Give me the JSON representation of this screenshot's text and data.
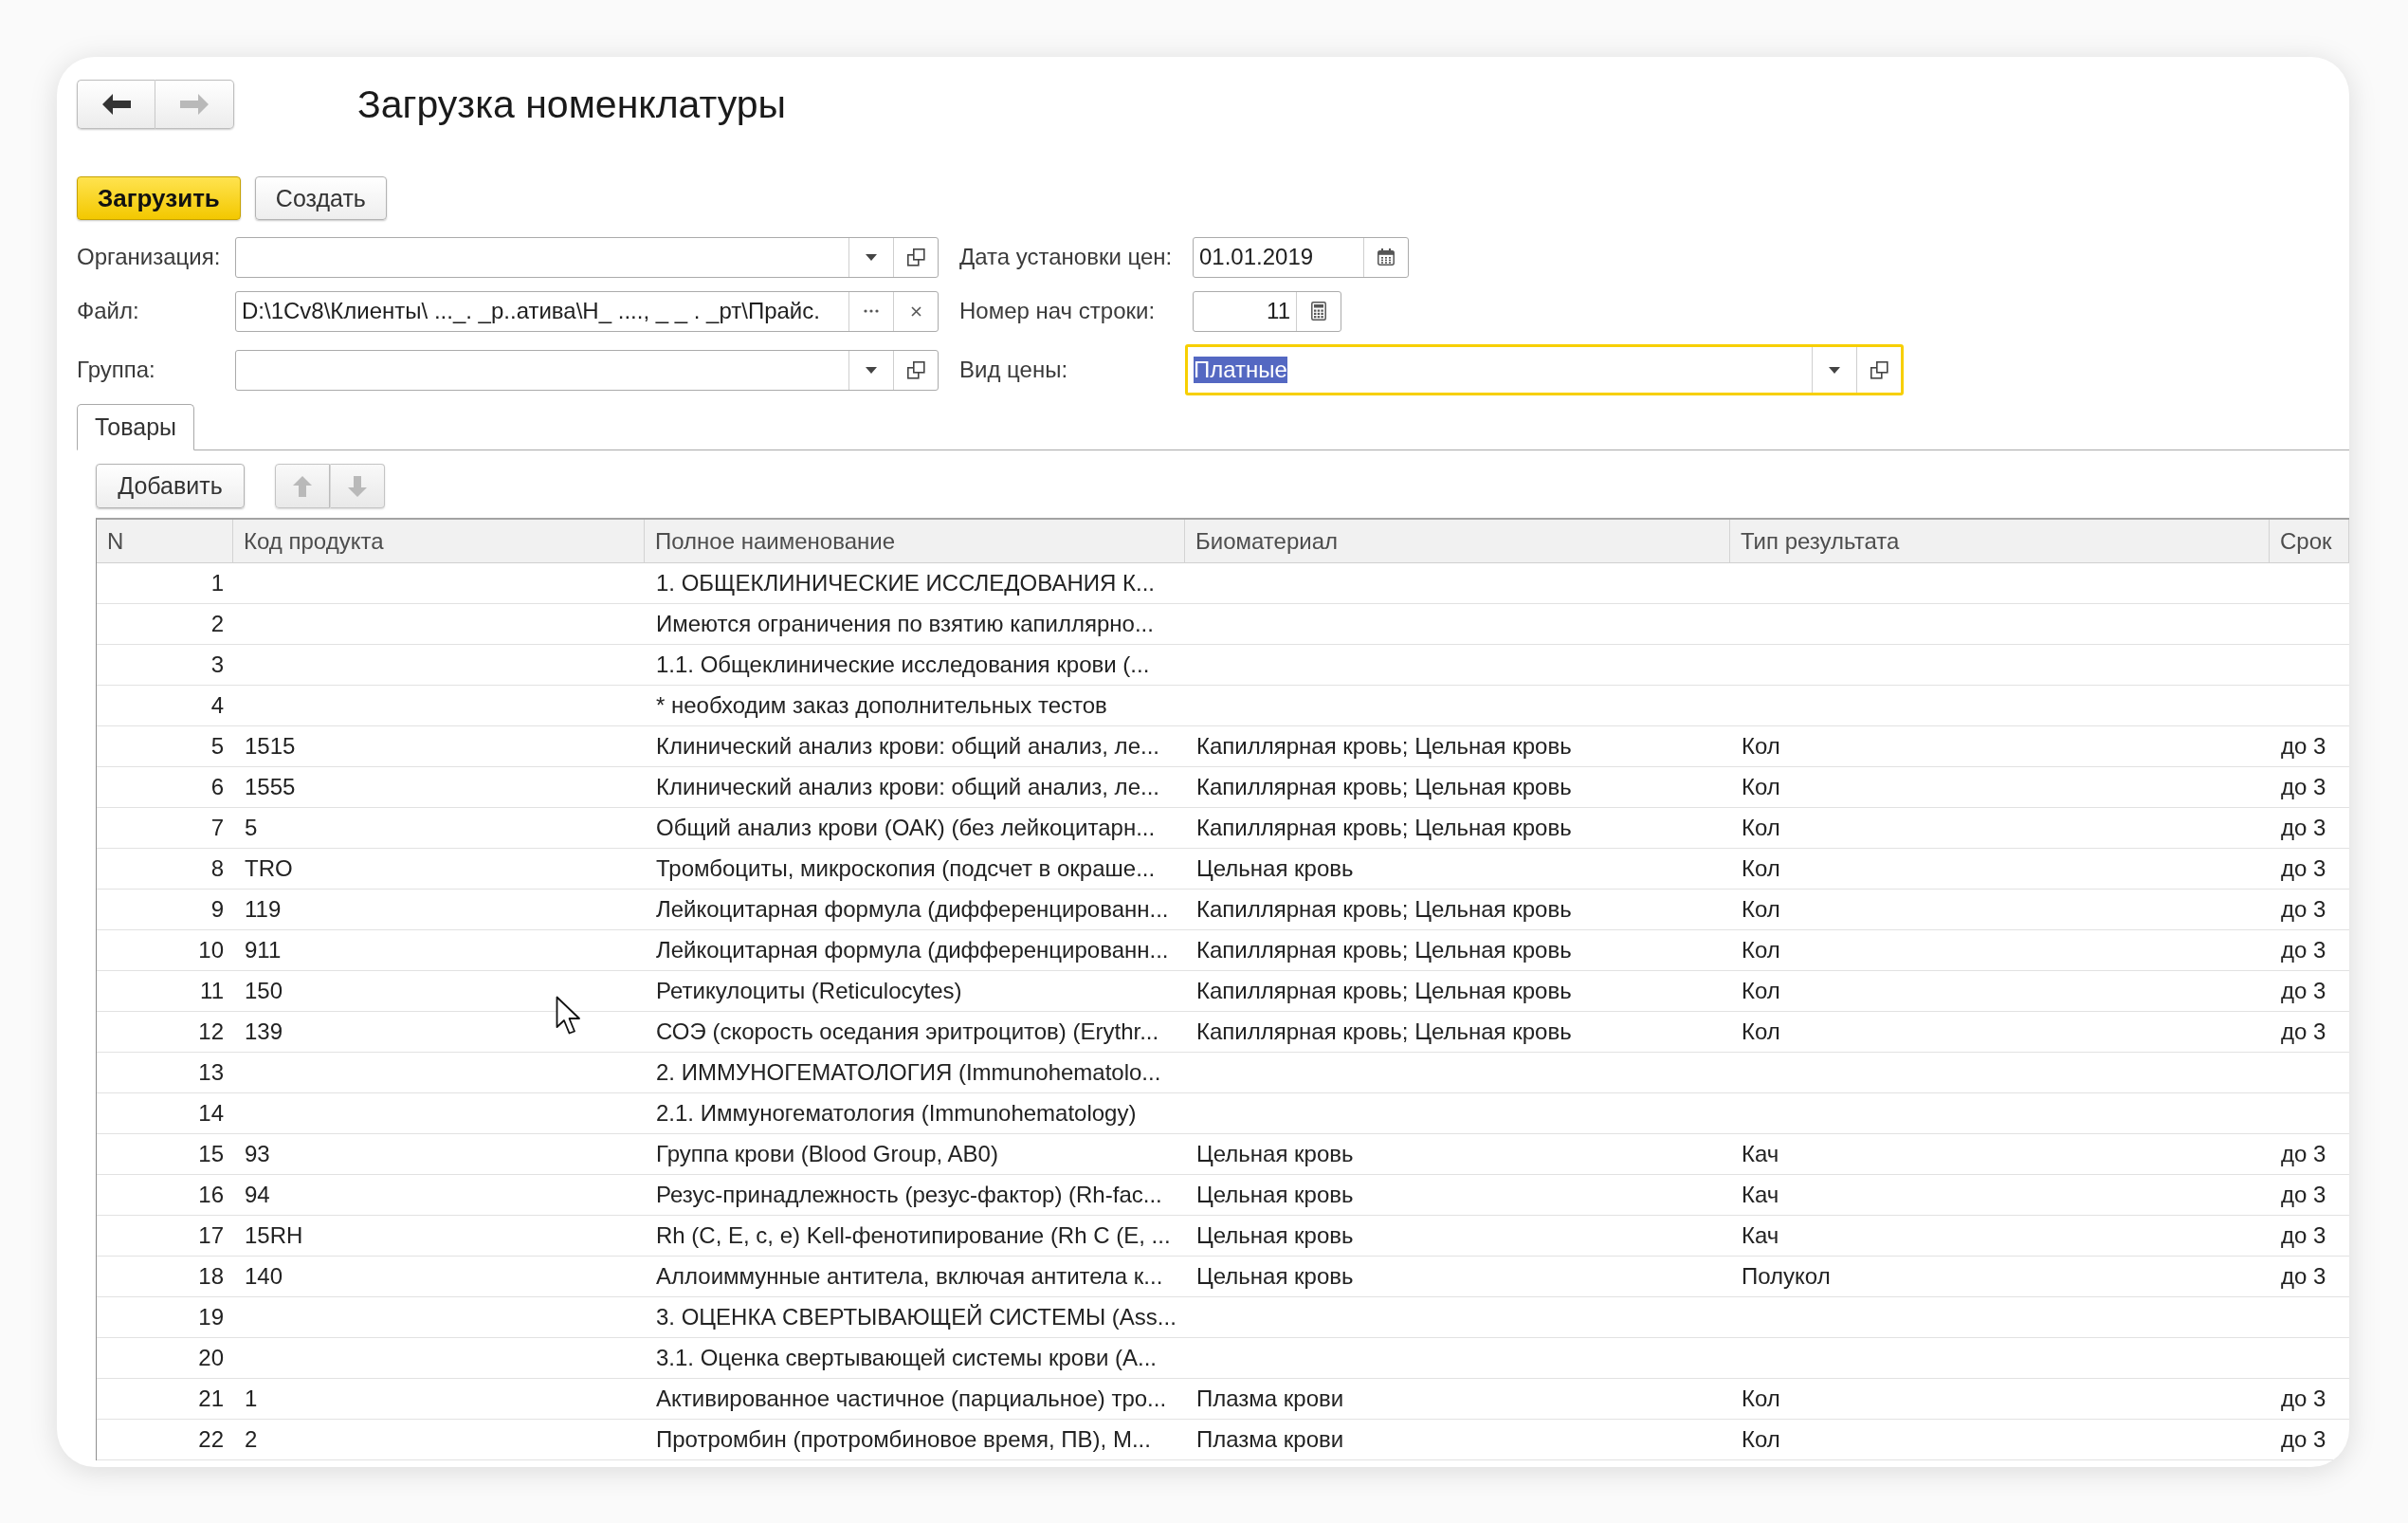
{
  "nav": [
    {
      "kind": "back",
      "disabled": false
    },
    {
      "kind": "forward",
      "disabled": true
    }
  ],
  "window": {
    "title": "Загрузка номенклатуры"
  },
  "commands": [
    {
      "label": "Загрузить",
      "default": true
    },
    {
      "label": "Создать",
      "default": false
    }
  ],
  "form_rows": [
    {
      "left": {
        "label": "Организация:",
        "kind": "choice",
        "focused": false
      },
      "right": {
        "label": "Дата установки цен:",
        "kind": "date",
        "value": "01.01.2019",
        "focused": false
      }
    },
    {
      "left": {
        "label": "Файл:",
        "kind": "file",
        "value": "D:\\1Cv8\\Клиенты\\ ..._. _р..атива\\Н_ ...., _ _ . _рт\\Прайс.",
        "focused": false
      },
      "right": {
        "label": "Номер нач строки:",
        "kind": "number",
        "value": "11",
        "focused": false
      }
    },
    {
      "left": {
        "label": "Группа:",
        "kind": "choice",
        "focused": false
      },
      "right": {
        "label": "Вид цены:",
        "kind": "choice",
        "value": "Платные",
        "focused": true
      }
    }
  ],
  "tabs": [
    {
      "label": "Товары",
      "selected": true
    }
  ],
  "toolbar": {
    "add_button": "Добавить",
    "move_buttons": [
      {
        "kind": "up",
        "disabled": true
      },
      {
        "kind": "down",
        "disabled": true
      }
    ]
  },
  "table": {
    "columns": [
      "N",
      "Код продукта",
      "Полное наименование",
      "Биоматериал",
      "Тип результата",
      "Срок"
    ],
    "rows": [
      {
        "n": "1",
        "name": "1. ОБЩЕКЛИНИЧЕСКИЕ ИССЛЕДОВАНИЯ К..."
      },
      {
        "n": "2",
        "name": "Имеются ограничения по взятию капиллярно..."
      },
      {
        "n": "3",
        "name": "1.1. Общеклинические исследования крови (..."
      },
      {
        "n": "4",
        "name": "* необходим заказ дополнительных тестов"
      },
      {
        "n": "5",
        "code": "1515",
        "name": "Клинический анализ крови: общий анализ, ле...",
        "biomaterial": "Капиллярная кровь; Цельная кровь",
        "result_type": "Кол",
        "term": "до 3"
      },
      {
        "n": "6",
        "code": "1555",
        "name": "Клинический анализ крови: общий анализ, ле...",
        "biomaterial": "Капиллярная кровь; Цельная кровь",
        "result_type": "Кол",
        "term": "до 3"
      },
      {
        "n": "7",
        "code": "5",
        "name": "Общий анализ крови (ОАК) (без лейкоцитарн...",
        "biomaterial": "Капиллярная кровь; Цельная кровь",
        "result_type": "Кол",
        "term": "до 3"
      },
      {
        "n": "8",
        "code": "TRO",
        "name": "Тромбоциты, микроскопия (подсчет в окраше...",
        "biomaterial": "Цельная кровь",
        "result_type": "Кол",
        "term": "до 3"
      },
      {
        "n": "9",
        "code": "119",
        "name": "Лейкоцитарная формула (дифференцированн...",
        "biomaterial": "Капиллярная кровь; Цельная кровь",
        "result_type": "Кол",
        "term": "до 3"
      },
      {
        "n": "10",
        "code": "911",
        "name": "Лейкоцитарная формула (дифференцированн...",
        "biomaterial": "Капиллярная кровь; Цельная кровь",
        "result_type": "Кол",
        "term": "до 3"
      },
      {
        "n": "11",
        "code": "150",
        "name": "Ретикулоциты (Reticulocytes)",
        "biomaterial": "Капиллярная кровь; Цельная кровь",
        "result_type": "Кол",
        "term": "до 3"
      },
      {
        "n": "12",
        "code": "139",
        "name": "СОЭ (скорость оседания эритроцитов) (Erythr...",
        "biomaterial": "Капиллярная кровь; Цельная кровь",
        "result_type": "Кол",
        "term": "до 3"
      },
      {
        "n": "13",
        "name": "2. ИММУНОГЕМАТОЛОГИЯ (Immunohematolo..."
      },
      {
        "n": "14",
        "name": "2.1. Иммуногематология (Immunohematology)"
      },
      {
        "n": "15",
        "code": "93",
        "name": "Группа крови (Blood Group, AB0)",
        "biomaterial": "Цельная кровь",
        "result_type": "Кач",
        "term": "до 3"
      },
      {
        "n": "16",
        "code": "94",
        "name": "Резус-принадлежность (резус-фактор) (Rh-fac...",
        "biomaterial": "Цельная кровь",
        "result_type": "Кач",
        "term": "до 3"
      },
      {
        "n": "17",
        "code": "15RH",
        "name": "Rh (C, E, c, e) Kell-фенотипирование (Rh C (E, ...",
        "biomaterial": "Цельная кровь",
        "result_type": "Кач",
        "term": "до 3"
      },
      {
        "n": "18",
        "code": "140",
        "name": "Аллоиммунные антитела, включая антитела к...",
        "biomaterial": "Цельная кровь",
        "result_type": "Полукол",
        "term": "до 3"
      },
      {
        "n": "19",
        "name": "3. ОЦЕНКА СВЕРТЫВАЮЩЕЙ СИСТЕМЫ (Ass..."
      },
      {
        "n": "20",
        "name": "3.1. Оценка свертывающей системы крови (A..."
      },
      {
        "n": "21",
        "code": "1",
        "name": "Активированное частичное (парциальное) тро...",
        "biomaterial": "Плазма крови",
        "result_type": "Кол",
        "term": "до 3"
      },
      {
        "n": "22",
        "code": "2",
        "name": "Протромбин (протромбиновое время, ПВ), М...",
        "biomaterial": "Плазма крови",
        "result_type": "Кол",
        "term": "до 3"
      }
    ]
  }
}
